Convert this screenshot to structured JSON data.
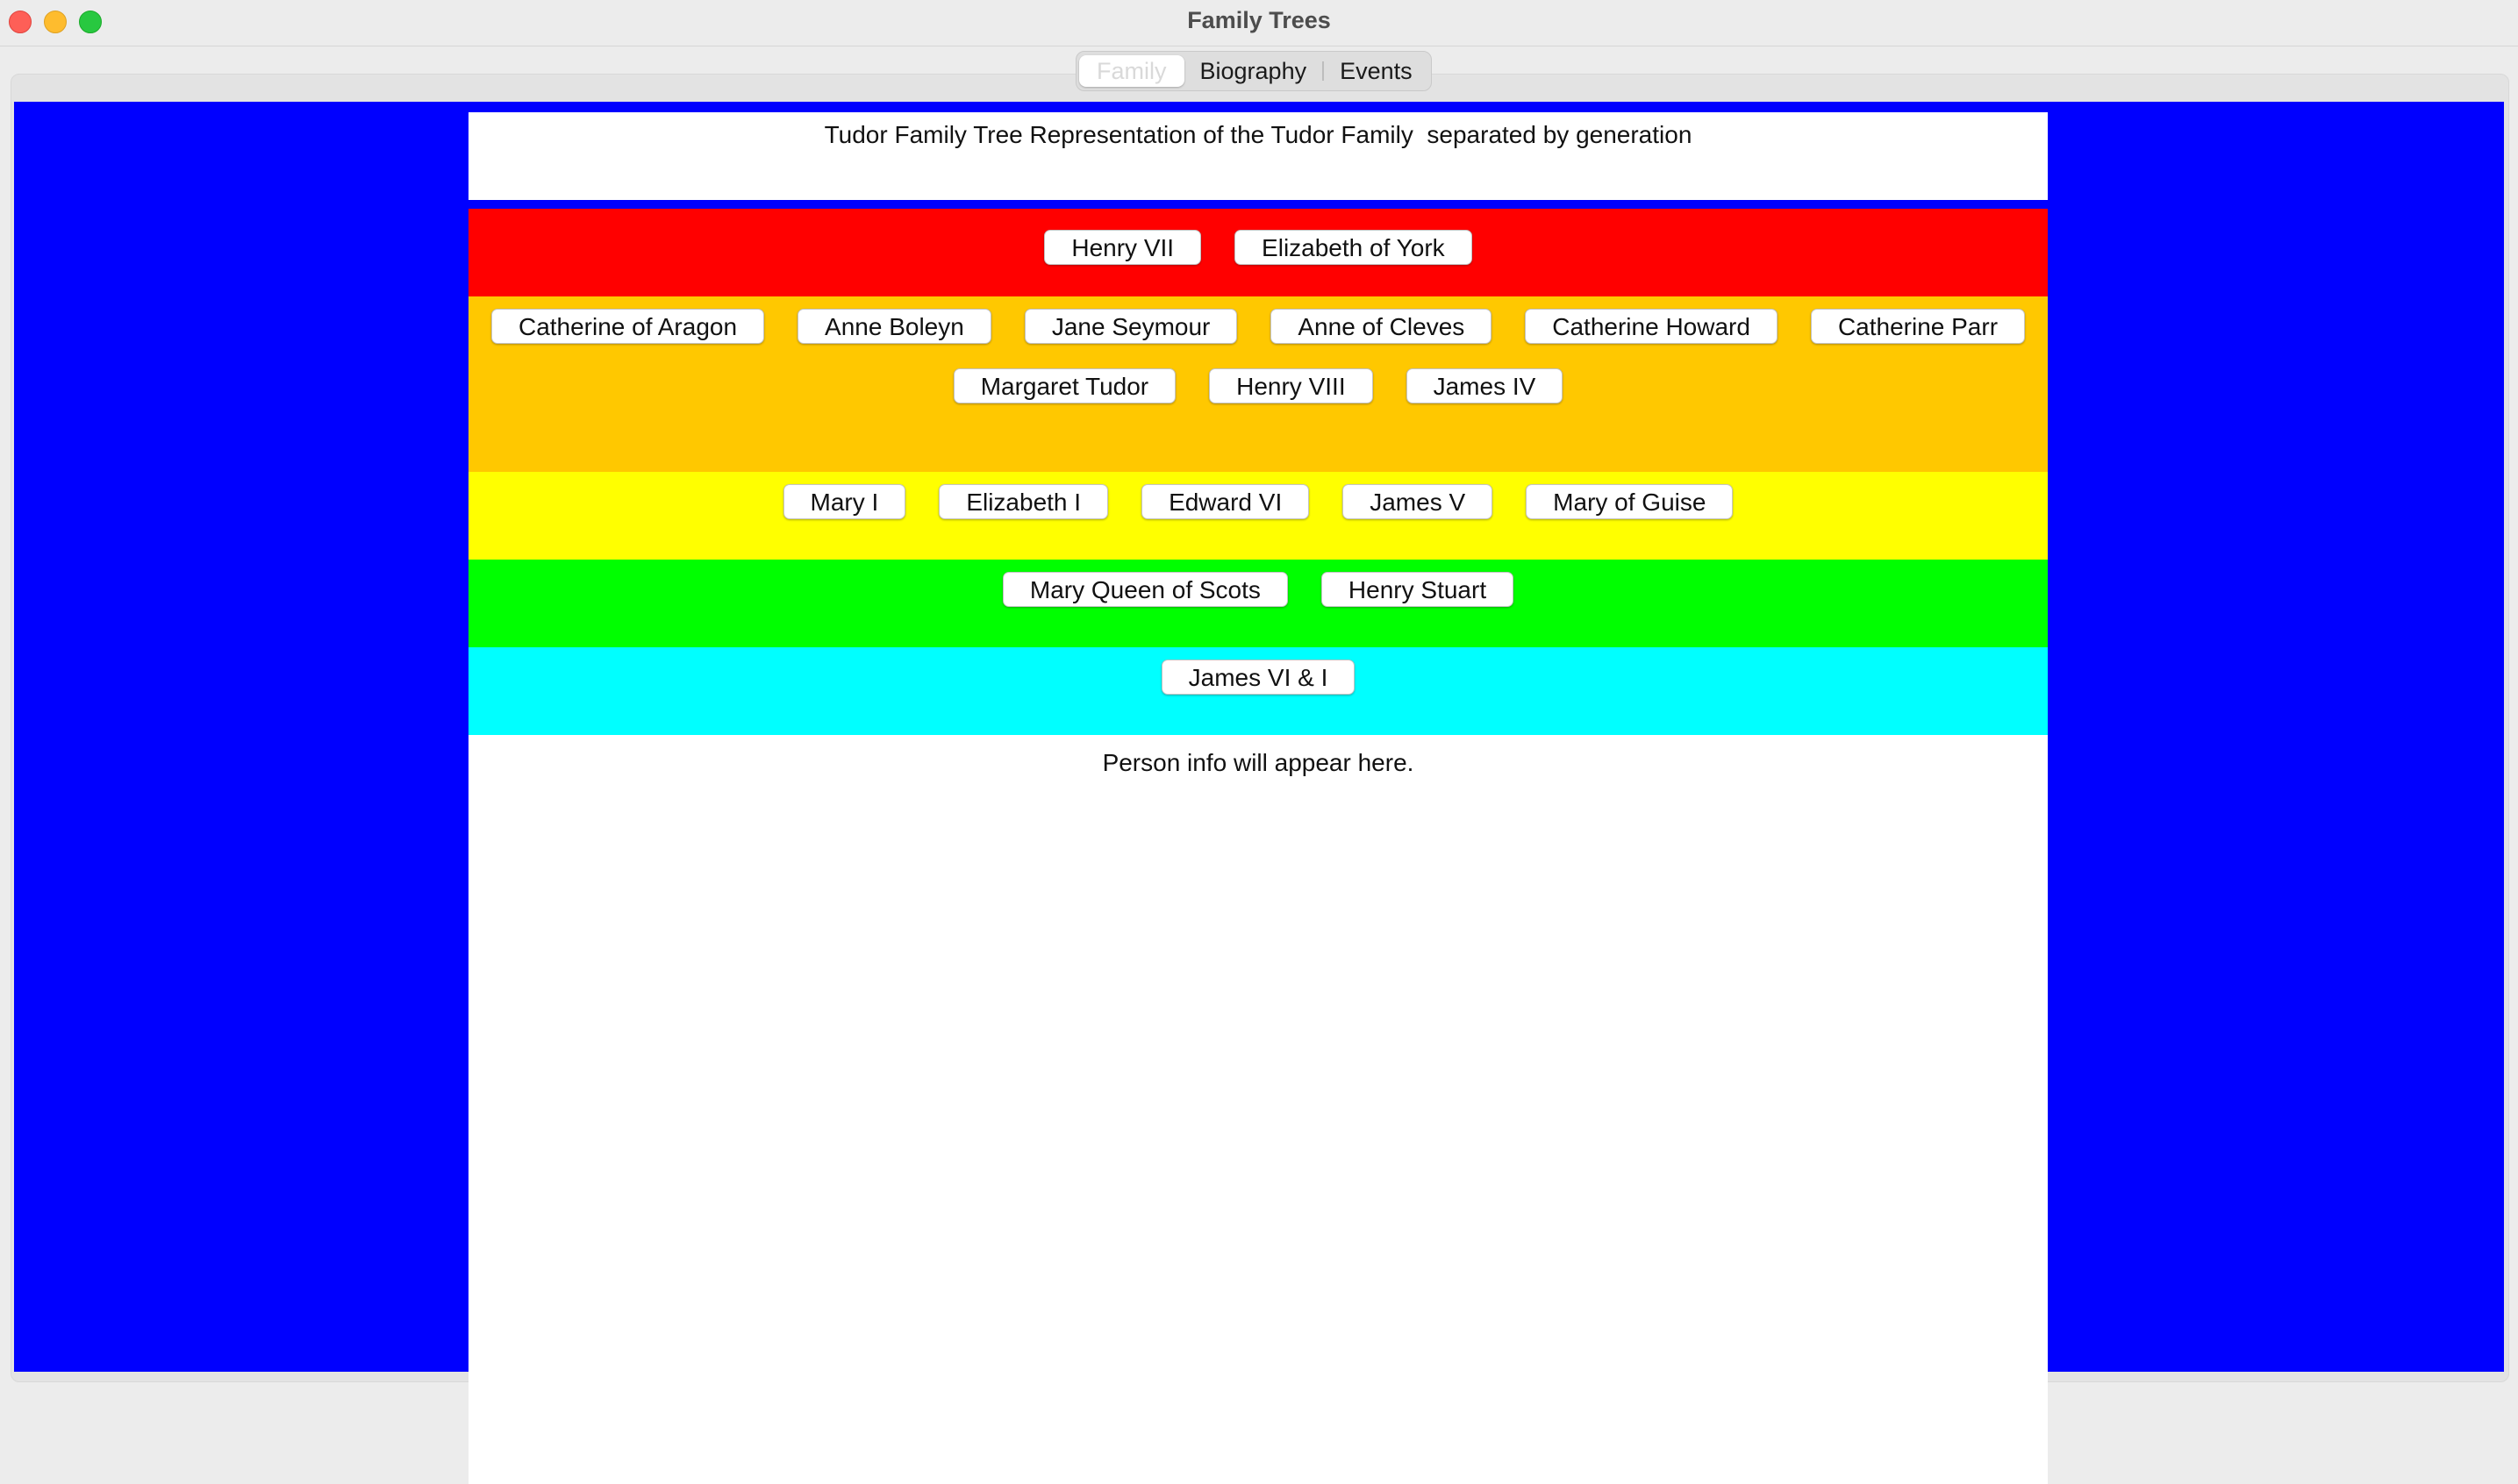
{
  "window": {
    "title": "Family Trees"
  },
  "tabs": [
    {
      "label": "Family",
      "active": true
    },
    {
      "label": "Biography",
      "active": false
    },
    {
      "label": "Events",
      "active": false
    }
  ],
  "header": {
    "text": "Tudor Family Tree Representation of the Tudor Family  separated by generation"
  },
  "generations": [
    {
      "color": "#ff0000",
      "rows": [
        [
          "Henry VII",
          "Elizabeth of York"
        ]
      ]
    },
    {
      "color": "#ffc800",
      "rows": [
        [
          "Catherine of Aragon",
          "Anne Boleyn",
          "Jane Seymour",
          "Anne of Cleves",
          "Catherine Howard",
          "Catherine Parr"
        ],
        [
          "Margaret Tudor",
          "Henry VIII",
          "James IV"
        ]
      ]
    },
    {
      "color": "#ffff00",
      "rows": [
        [
          "Mary I",
          "Elizabeth I",
          "Edward VI",
          "James V",
          "Mary of Guise"
        ]
      ]
    },
    {
      "color": "#00ff00",
      "rows": [
        [
          "Mary Queen of Scots",
          "Henry Stuart"
        ]
      ]
    },
    {
      "color": "#00ffff",
      "rows": [
        [
          "James VI & I"
        ]
      ]
    }
  ],
  "info": {
    "placeholder": "Person info will appear here."
  },
  "colors": {
    "background": "#0000ff"
  }
}
